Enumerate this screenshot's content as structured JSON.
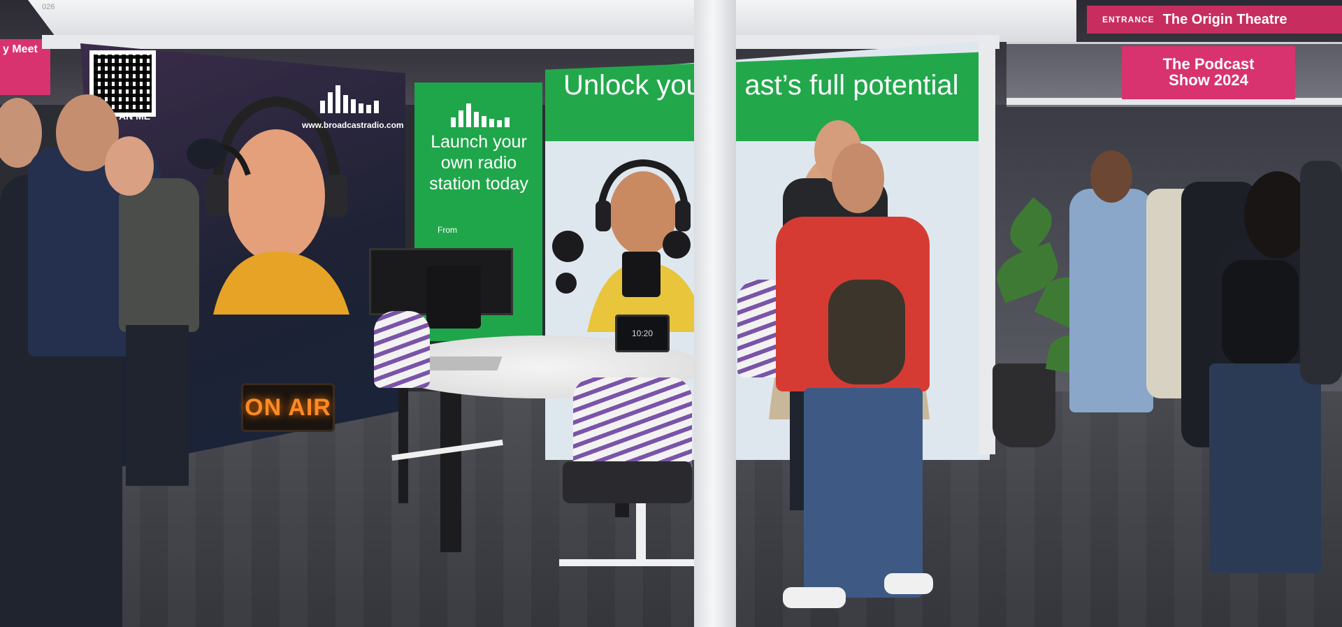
{
  "scene": {
    "colors": {
      "brand_green": "#22a84b",
      "podcast_pink": "#d8336e",
      "on_air_orange": "#ff8a24"
    }
  },
  "signage": {
    "left_panel": {
      "scan_label": "AN ME",
      "website": "www.broadcastradio.com",
      "on_air": "ON AIR"
    },
    "green_panel": {
      "headline": "Launch your own radio station today",
      "from_label": "From"
    },
    "right_panel": {
      "headline": "Unlock your P   ast’s full potential"
    },
    "venue_signs": {
      "entrance": "ENTRANCE",
      "theatre": "The Origin Theatre",
      "podcast_show_line1": "The Podcast",
      "podcast_show_line2": "Show 2024",
      "left_top_sign": "y Meet"
    },
    "booth_number": "026"
  },
  "table_clock": "10:20"
}
